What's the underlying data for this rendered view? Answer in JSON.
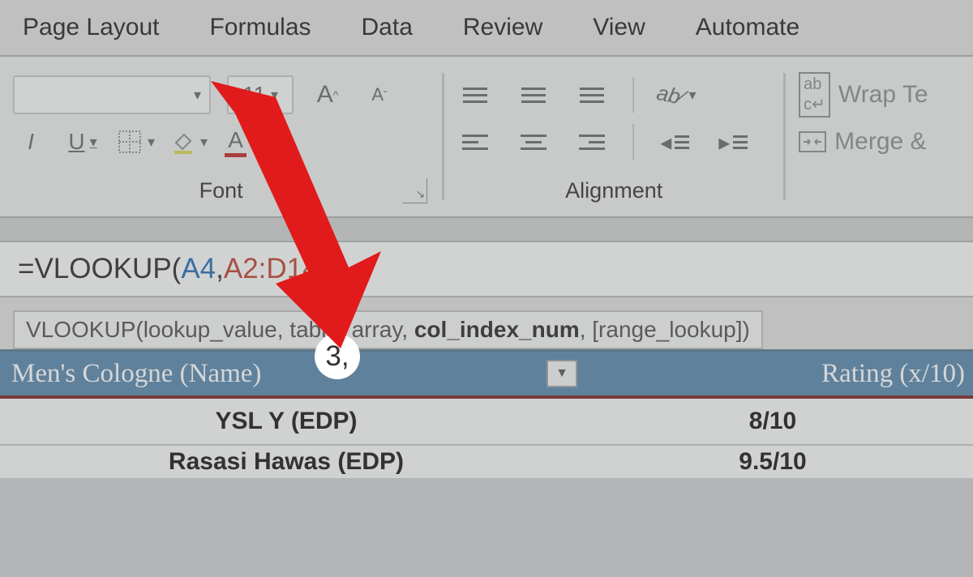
{
  "tabs": {
    "page_layout": "Page Layout",
    "formulas": "Formulas",
    "data": "Data",
    "review": "Review",
    "view": "View",
    "automate": "Automate"
  },
  "ribbon": {
    "font_label": "Font",
    "alignment_label": "Alignment",
    "wrap_text": "Wrap Te",
    "merge": "Merge &",
    "font_size": "11",
    "increase_font": "A",
    "decrease_font": "A",
    "italic": "I",
    "underline": "U",
    "font_color": "A"
  },
  "formula": {
    "prefix": "=VLOOKUP(",
    "arg1": "A4",
    "comma1": ",",
    "arg2": "A2:D14",
    "comma2": ", ",
    "arg3": "3",
    "comma3": ","
  },
  "tooltip": {
    "fn": "VLOOKUP",
    "sig_plain1": "(lookup_value, table_array, ",
    "sig_bold": "col_index_num",
    "sig_plain2": ", [range_lookup])"
  },
  "sheet": {
    "col1_header": "Men's Cologne (Name)",
    "col2_header": "Rating (x/10)",
    "rows": [
      {
        "name": "YSL Y (EDP)",
        "rating": "8/10"
      },
      {
        "name": "Rasasi Hawas (EDP)",
        "rating": "9.5/10"
      }
    ]
  },
  "highlight_char": "3"
}
